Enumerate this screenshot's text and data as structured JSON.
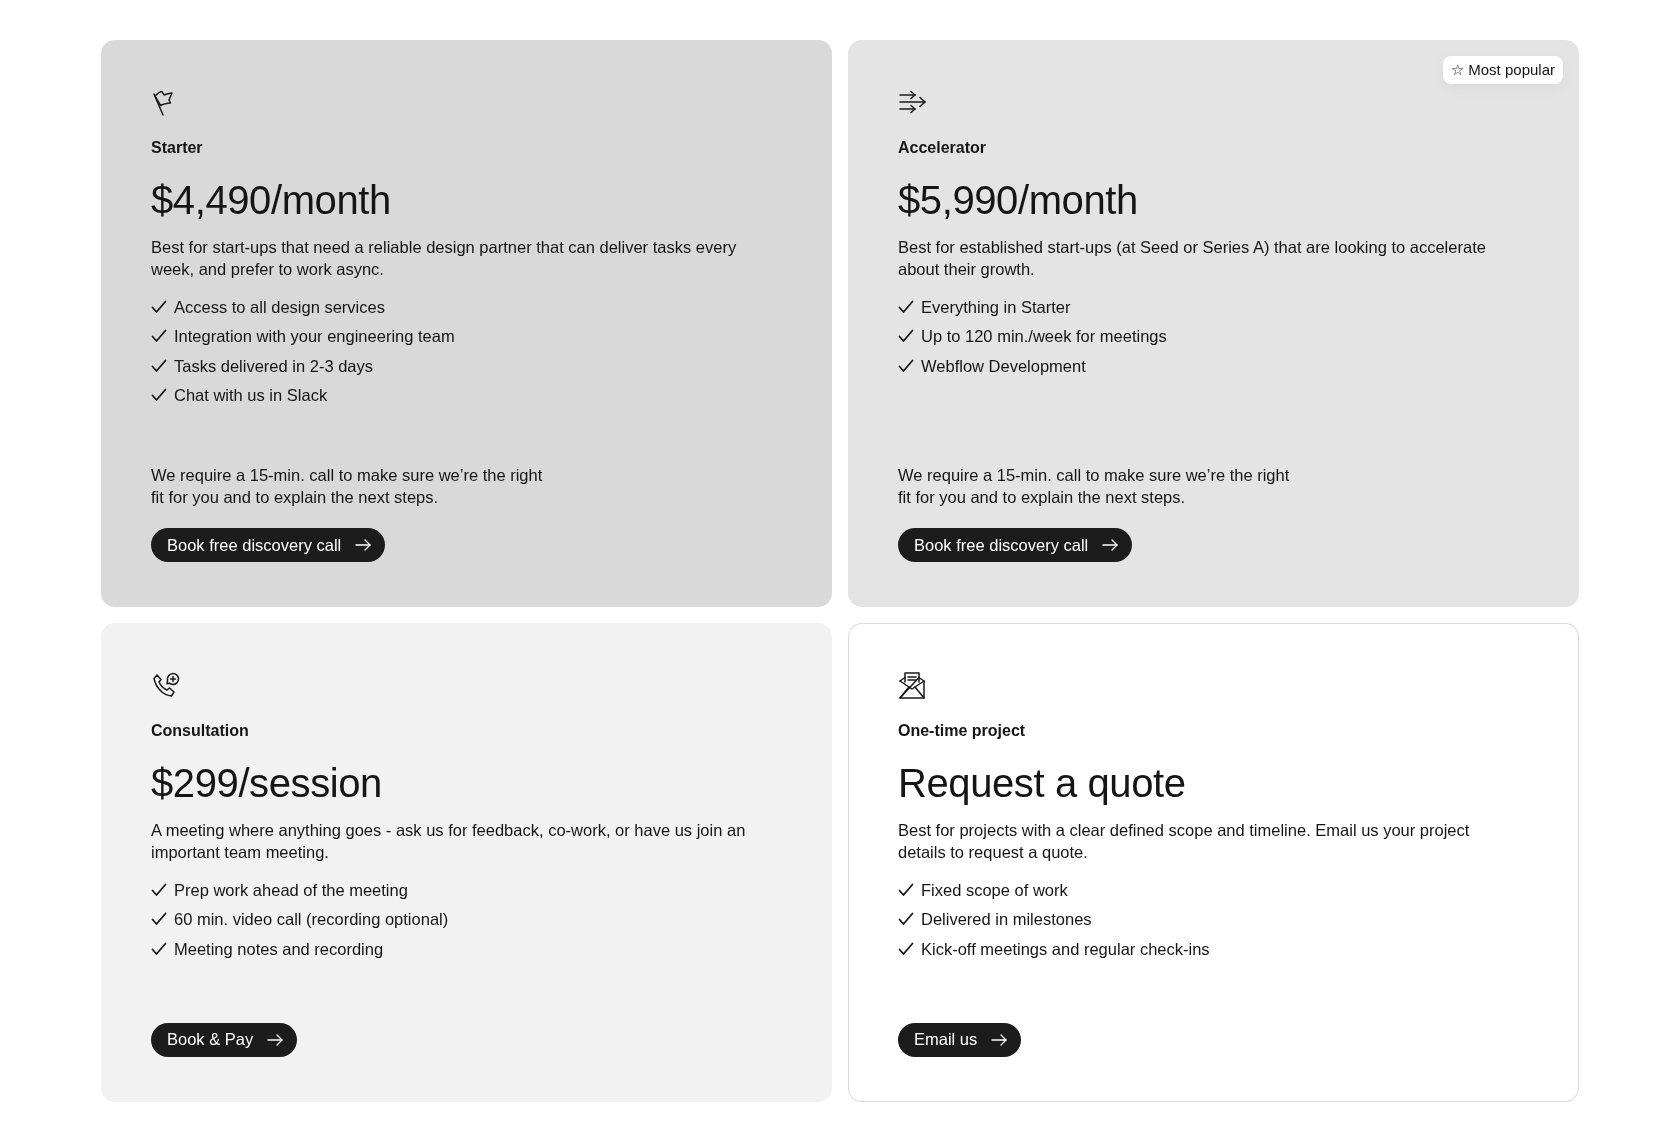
{
  "popular_badge": "☆ Most popular",
  "plans": [
    {
      "name": "Starter",
      "popular": false,
      "price": "$4,490/month",
      "description": "Best for start-ups that need a reliable design partner that can deliver tasks every week, and prefer to work async.",
      "features": [
        "Access to all design services",
        "Integration with your engineering team",
        "Tasks delivered in 2-3 days",
        "Chat with us in Slack"
      ],
      "note": "We require a 15-min. call to make sure we’re the right fit for you and to explain the next steps.",
      "cta": "Book free discovery call",
      "color": "#d9d9d9",
      "outlined": false
    },
    {
      "name": "Accelerator",
      "popular": true,
      "price": "$5,990/month",
      "description": "Best for established start-ups (at Seed or Series A) that are looking to accelerate about their growth.",
      "features": [
        "Everything in Starter",
        "Up to 120 min./week for meetings",
        "Webflow Development"
      ],
      "note": "We require a 15-min. call to make sure we’re the right fit for you and to explain the next steps.",
      "cta": "Book free discovery call",
      "color": "#e4e4e4",
      "outlined": false
    },
    {
      "name": "Consultation",
      "popular": false,
      "price": "$299/session",
      "description": "A meeting where anything goes - ask us for feedback, co-work, or have us join an important team meeting.",
      "features": [
        "Prep work ahead of the meeting",
        "60 min. video call (recording optional)",
        "Meeting notes and recording"
      ],
      "cta": "Book & Pay",
      "color": "#f2f2f2",
      "outlined": false
    },
    {
      "name": "One-time project",
      "popular": false,
      "price": "Request a quote",
      "description": "Best for projects with a clear defined scope and timeline. Email us your project details to request a quote.",
      "features": [
        "Fixed scope of work",
        "Delivered in milestones",
        "Kick-off meetings and regular check-ins"
      ],
      "cta": "Email us",
      "color": "#ffffff",
      "outlined": true
    }
  ]
}
